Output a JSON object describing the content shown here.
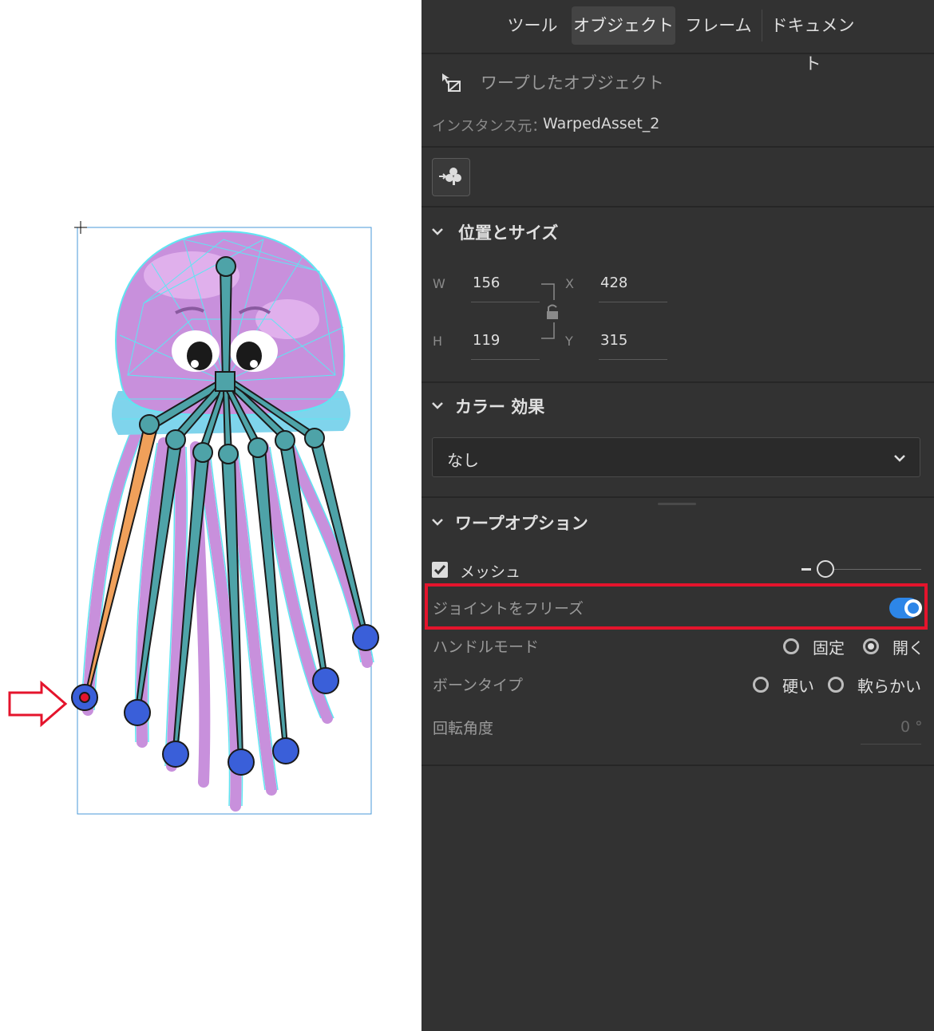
{
  "tabs": [
    {
      "label": "ツール",
      "active": false
    },
    {
      "label": "オブジェクト",
      "active": true
    },
    {
      "label": "フレーム",
      "active": false
    },
    {
      "label": "ドキュメント",
      "active": false
    }
  ],
  "object": {
    "title": "ワープしたオブジェクト",
    "instance_label": "インスタンス元：",
    "instance_value": "WarpedAsset_2",
    "swap_icon": "swap-symbol-icon"
  },
  "position_size": {
    "title": "位置とサイズ",
    "w_label": "W",
    "w_value": "156",
    "h_label": "H",
    "h_value": "119",
    "x_label": "X",
    "x_value": "428",
    "y_label": "Y",
    "y_value": "315",
    "lock_icon": "lock-open-icon"
  },
  "color_effect": {
    "title": "カラー 効果",
    "selected": "なし"
  },
  "warp_options": {
    "title": "ワープオプション",
    "mesh_label": "メッシュ",
    "mesh_checked": true,
    "freeze_joints_label": "ジョイントをフリーズ",
    "freeze_joints_on": true,
    "handle_mode_label": "ハンドルモード",
    "handle_mode_options": [
      {
        "label": "固定",
        "selected": false
      },
      {
        "label": "開く",
        "selected": true
      }
    ],
    "bone_type_label": "ボーンタイプ",
    "bone_type_options": [
      {
        "label": "硬い",
        "selected": false
      },
      {
        "label": "軟らかい",
        "selected": false
      }
    ],
    "rotation_label": "回転角度",
    "rotation_value": "0 °"
  },
  "colors": {
    "panel_bg": "#323232",
    "highlight": "#e4142c",
    "toggle": "#2d86e8",
    "mesh_line": "#5fe6f2",
    "bone": "#4ea3a8",
    "bone_selected": "#f0a05a",
    "joint": "#3a5fd9",
    "jelly_body": "#c890dc",
    "arrow": "#e4142c"
  }
}
